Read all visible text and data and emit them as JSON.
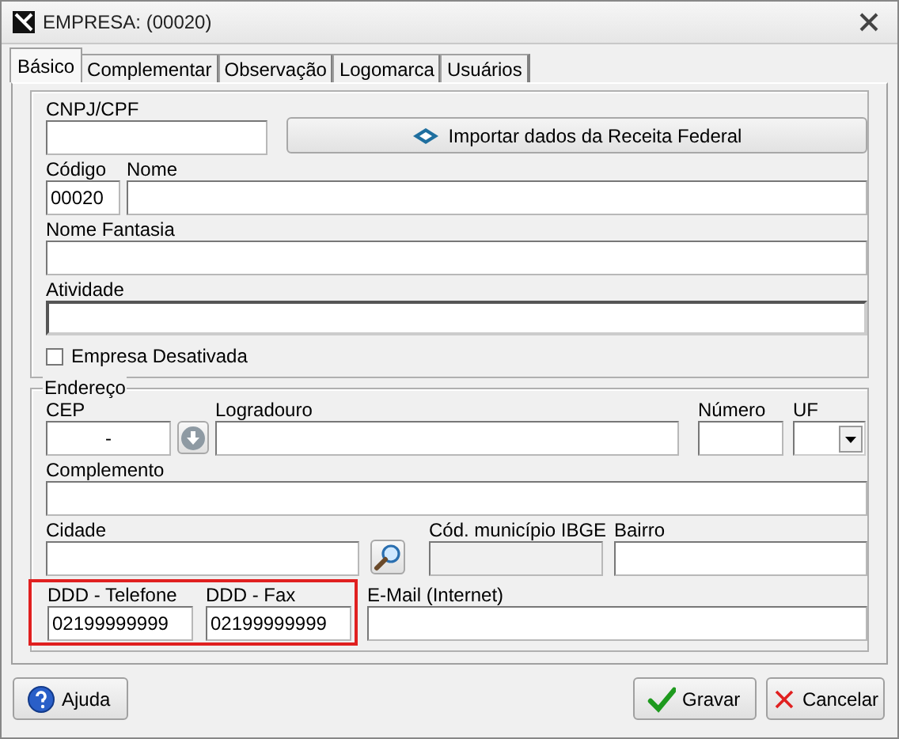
{
  "window": {
    "title": "EMPRESA: (00020)"
  },
  "tabs": [
    {
      "label": "Básico",
      "selected": true
    },
    {
      "label": "Complementar",
      "selected": false
    },
    {
      "label": "Observação",
      "selected": false
    },
    {
      "label": "Logomarca",
      "selected": false
    },
    {
      "label": "Usuários",
      "selected": false
    }
  ],
  "company": {
    "rows": [
      [
        {
          "kind": "field",
          "label": "CNPJ/CPF"
        },
        {
          "kind": "button",
          "label": "Importar dados da Receita Federal"
        }
      ],
      [
        {
          "kind": "field",
          "label": "Código",
          "value": "00020"
        },
        {
          "kind": "field",
          "label": "Nome"
        }
      ],
      [
        {
          "kind": "field",
          "label": "Nome Fantasia"
        }
      ],
      [
        {
          "kind": "field",
          "label": "Atividade",
          "focused": true
        }
      ]
    ],
    "checkbox": {
      "label": "Empresa Desativada",
      "checked": false
    }
  },
  "address": {
    "title": "Endereço",
    "rows": [
      [
        {
          "kind": "field",
          "label": "CEP",
          "value": "-"
        },
        {
          "kind": "lookup"
        },
        {
          "kind": "field",
          "label": "Logradouro"
        },
        {
          "kind": "field",
          "label": "Número"
        },
        {
          "kind": "combo",
          "label": "UF"
        }
      ],
      [
        {
          "kind": "field",
          "label": "Complemento"
        }
      ],
      [
        {
          "kind": "field",
          "label": "Cidade"
        },
        {
          "kind": "search"
        },
        {
          "kind": "field",
          "label": "Cód. município IBGE",
          "disabled": true
        },
        {
          "kind": "field",
          "label": "Bairro"
        }
      ],
      [
        {
          "kind": "group",
          "highlighted": true,
          "items": [
            {
              "kind": "field",
              "label": "DDD - Telefone",
              "value": "02199999999"
            },
            {
              "kind": "field",
              "label": "DDD - Fax",
              "value": "02199999999"
            }
          ]
        },
        {
          "kind": "field",
          "label": "E-Mail (Internet)"
        }
      ]
    ]
  },
  "buttons": [
    {
      "kind": "help",
      "label": "Ajuda"
    },
    {
      "kind": "save",
      "label": "Gravar"
    },
    {
      "kind": "cancel",
      "label": "Cancelar"
    }
  ]
}
